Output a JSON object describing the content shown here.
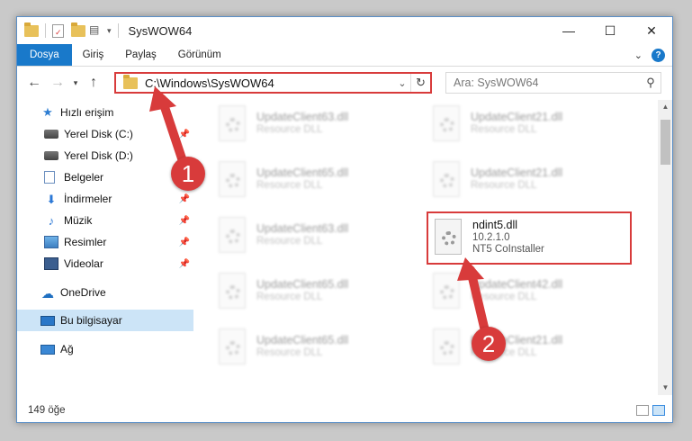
{
  "window": {
    "title": "SysWOW64",
    "controls": {
      "minimize": "—",
      "maximize": "☐",
      "close": "✕"
    }
  },
  "ribbon": {
    "tabs": [
      "Dosya",
      "Giriş",
      "Paylaş",
      "Görünüm"
    ],
    "active_tab": "Dosya",
    "accent": "#1979ca"
  },
  "address": {
    "path": "C:\\Windows\\SysWOW64",
    "search_placeholder": "Ara: SysWOW64"
  },
  "nav": {
    "items": [
      {
        "label": "Hızlı erişim",
        "icon": "star-icon"
      },
      {
        "label": "Yerel Disk (C:)",
        "icon": "disk-icon",
        "pinned": true
      },
      {
        "label": "Yerel Disk (D:)",
        "icon": "disk-icon"
      },
      {
        "label": "Belgeler",
        "icon": "documents-icon"
      },
      {
        "label": "İndirmeler",
        "icon": "downloads-icon",
        "pinned": true
      },
      {
        "label": "Müzik",
        "icon": "music-icon",
        "pinned": true
      },
      {
        "label": "Resimler",
        "icon": "pictures-icon",
        "pinned": true
      },
      {
        "label": "Videolar",
        "icon": "videos-icon",
        "pinned": true
      },
      {
        "label": "OneDrive",
        "icon": "onedrive-icon"
      },
      {
        "label": "Bu bilgisayar",
        "icon": "this-pc-icon",
        "selected": true
      },
      {
        "label": "Ağ",
        "icon": "network-icon"
      }
    ]
  },
  "files": [
    {
      "name": "UpdateClient63.dll",
      "desc": "Resource DLL"
    },
    {
      "name": "UpdateClient21.dll",
      "desc": "Resource DLL"
    },
    {
      "name": "UpdateClient65.dll",
      "desc": "Resource DLL"
    },
    {
      "name": "UpdateClient21.dll",
      "desc": "Resource DLL"
    },
    {
      "name": "UpdateClient63.dll",
      "desc": "Resource DLL"
    },
    {
      "name": "ndint5.dll",
      "version": "10.2.1.0",
      "desc": "NT5 CoInstaller",
      "highlighted": true
    },
    {
      "name": "UpdateClient65.dll",
      "desc": "Resource DLL"
    },
    {
      "name": "UpdateClient42.dll",
      "desc": "Resource DLL"
    },
    {
      "name": "UpdateClient65.dll",
      "desc": "Resource DLL"
    },
    {
      "name": "UpdateClient21.dll",
      "desc": "Resource DLL"
    }
  ],
  "status": {
    "count": "149 öğe"
  },
  "annotations": {
    "step1": "1",
    "step2": "2",
    "color": "#d83b3b"
  }
}
